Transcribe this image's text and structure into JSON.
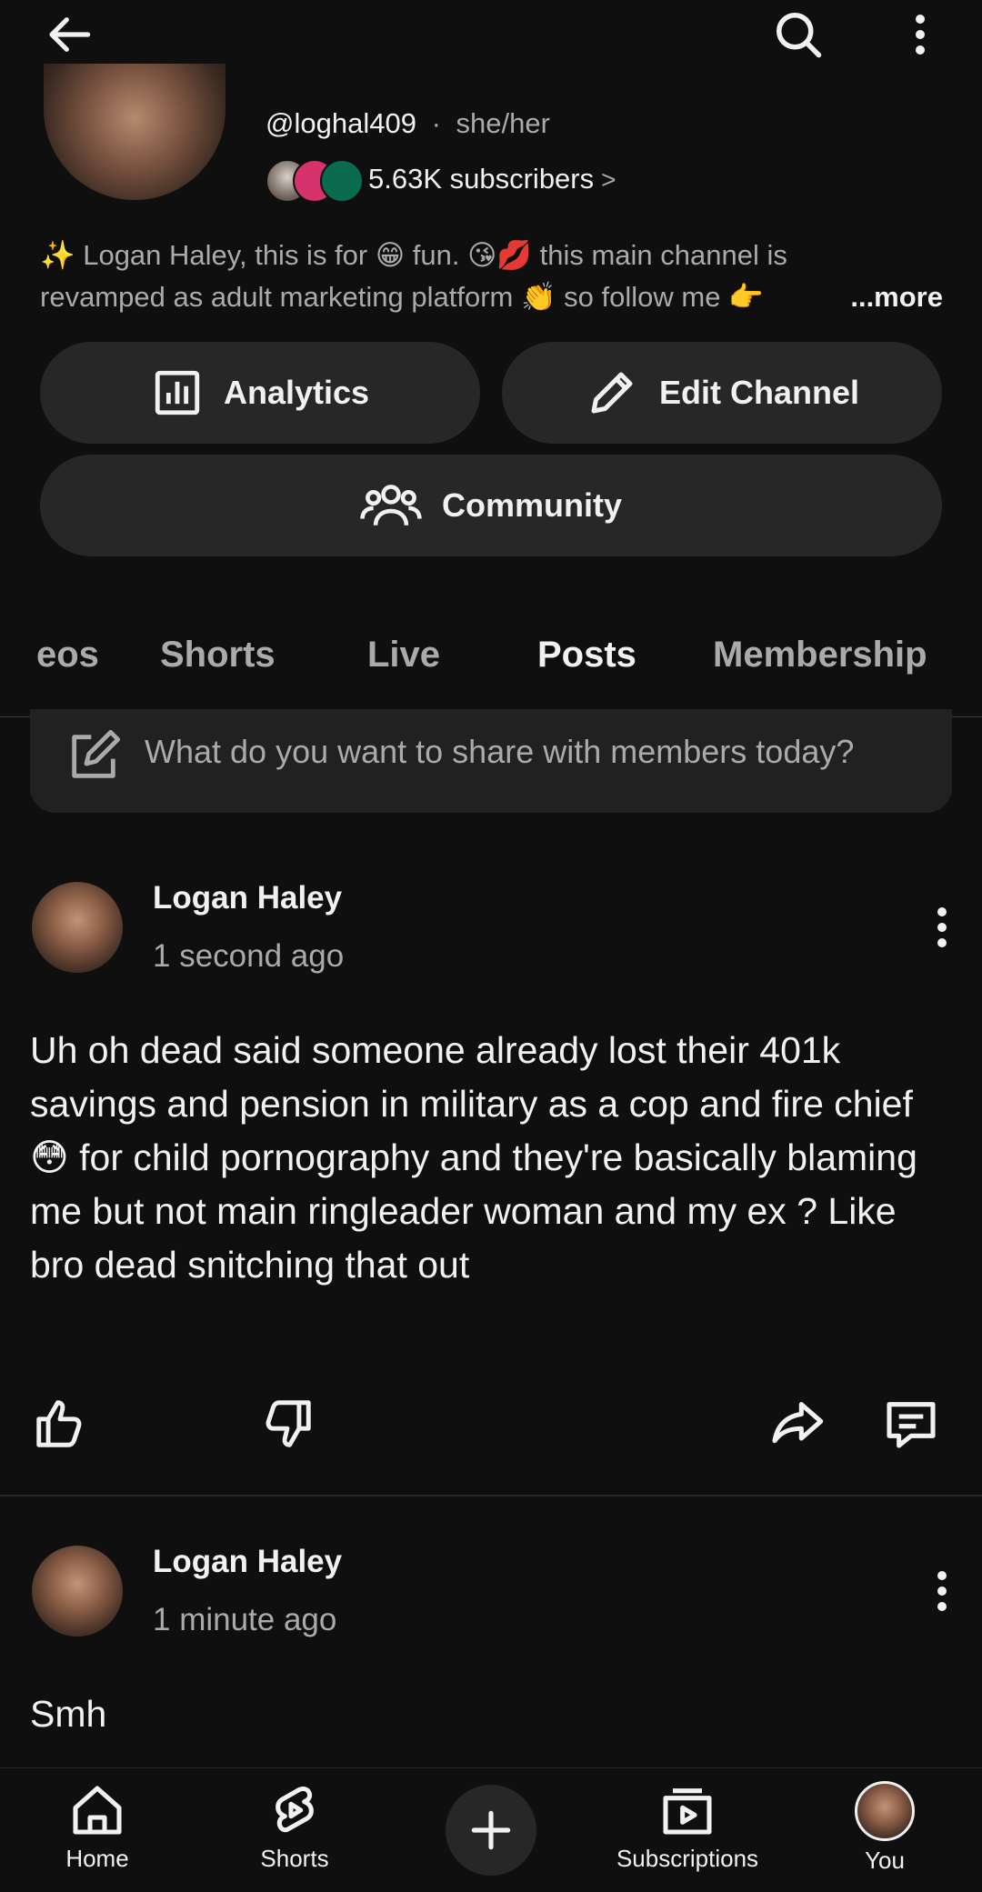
{
  "topbar": {
    "back_icon": "arrow-left-icon",
    "search_icon": "search-icon",
    "more_icon": "kebab-icon"
  },
  "channel": {
    "handle": "@loghal409",
    "separator": "·",
    "pronouns": "she/her",
    "subscribers": "5.63K subscribers",
    "subscribers_chevron": ">",
    "description_line1": "✨ Logan Haley, this is for 😁 fun. 😘💋 this main channel is",
    "description_line2": "revamped as adult marketing platform 👏 so follow me 👉",
    "more_label": "...more"
  },
  "actions": {
    "analytics_label": "Analytics",
    "edit_label": "Edit Channel",
    "community_label": "Community"
  },
  "tabs": [
    {
      "label": "eos",
      "active": false
    },
    {
      "label": "Shorts",
      "active": false
    },
    {
      "label": "Live",
      "active": false
    },
    {
      "label": "Posts",
      "active": true
    },
    {
      "label": "Membership",
      "active": false
    }
  ],
  "compose": {
    "placeholder": "What do you want to share with members today?"
  },
  "posts": [
    {
      "author": "Logan Haley",
      "time": "1 second ago",
      "body": "Uh oh dead said someone already lost their 401k savings and pension in military as a cop and fire chief 😳 for child pornography and they're basically blaming me but not main ringleader woman and my ex ? Like bro dead snitching that out"
    },
    {
      "author": "Logan Haley",
      "time": "1 minute ago",
      "body": "Smh"
    }
  ],
  "bottom_nav": {
    "home": "Home",
    "shorts": "Shorts",
    "create_icon": "plus-icon",
    "subscriptions": "Subscriptions",
    "you": "You"
  },
  "colors": {
    "background": "#0f0f0f",
    "surface": "#272727",
    "text": "#f1f1f1",
    "muted": "#aaaaaa"
  }
}
